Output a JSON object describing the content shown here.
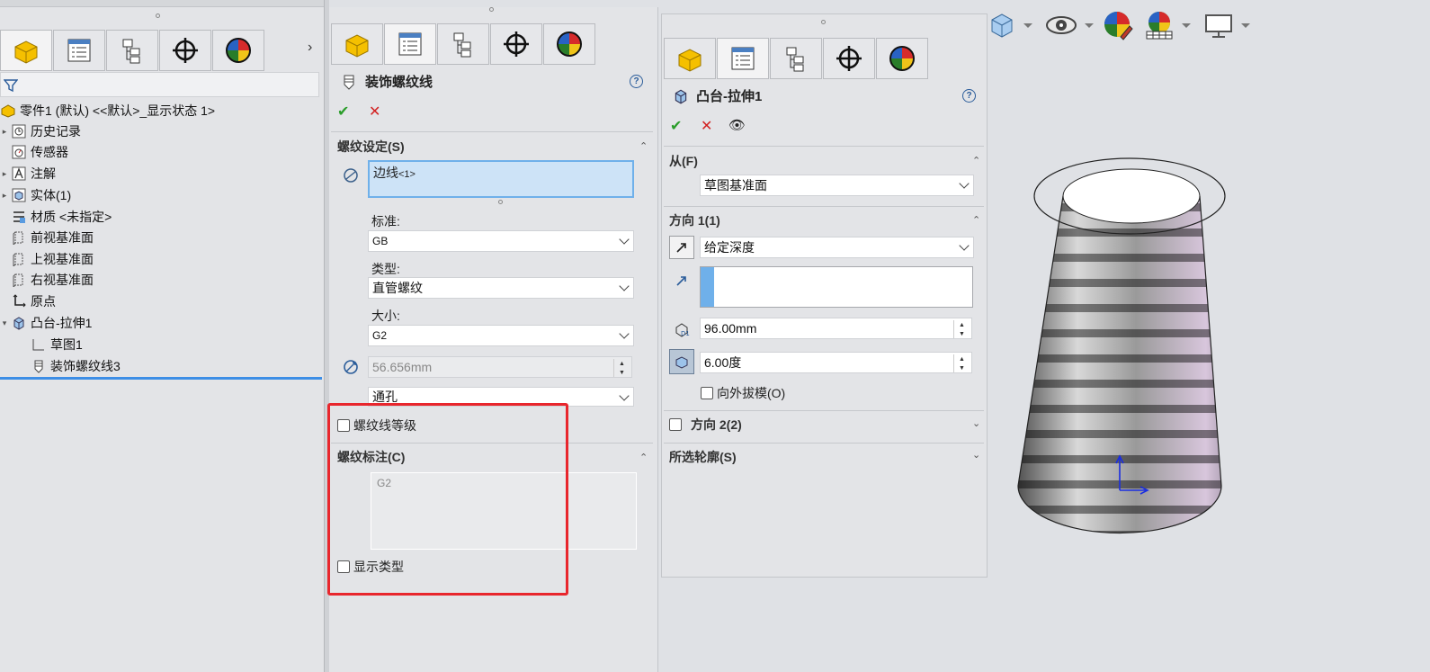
{
  "left_panel": {
    "filter_icon": "filter-icon",
    "tree": [
      {
        "label": "零件1 (默认) <<默认>_显示状态 1>",
        "icon": "part-icon",
        "expander": ""
      },
      {
        "label": "历史记录",
        "icon": "history-icon",
        "expander": "▸"
      },
      {
        "label": "传感器",
        "icon": "sensor-icon",
        "expander": ""
      },
      {
        "label": "注解",
        "icon": "annotation-icon",
        "expander": "▸"
      },
      {
        "label": "实体(1)",
        "icon": "solid-body-icon",
        "expander": "▸"
      },
      {
        "label": "材质 <未指定>",
        "icon": "material-icon",
        "expander": ""
      },
      {
        "label": "前视基准面",
        "icon": "plane-icon",
        "expander": ""
      },
      {
        "label": "上视基准面",
        "icon": "plane-icon",
        "expander": ""
      },
      {
        "label": "右视基准面",
        "icon": "plane-icon",
        "expander": ""
      },
      {
        "label": "原点",
        "icon": "origin-icon",
        "expander": ""
      },
      {
        "label": "凸台-拉伸1",
        "icon": "boss-extrude-icon",
        "expander": "▾"
      },
      {
        "label": "草图1",
        "icon": "sketch-icon",
        "expander": ""
      },
      {
        "label": "装饰螺纹线3",
        "icon": "cosmetic-thread-icon",
        "expander": ""
      }
    ]
  },
  "thread_panel": {
    "title": "装饰螺纹线",
    "help": "?",
    "section_settings": "螺纹设定(S)",
    "edge_value": "边线",
    "edge_sup": "<1>",
    "standard_label": "标准:",
    "standard_value": "GB",
    "type_label": "类型:",
    "type_value": "直管螺纹",
    "size_label": "大小:",
    "size_value": "G2",
    "diameter_value": "56.656mm",
    "end_condition_value": "通孔",
    "thread_class_label": "螺纹线等级",
    "section_callout": "螺纹标注(C)",
    "callout_value": "G2",
    "show_type_label": "显示类型"
  },
  "extrude_panel": {
    "title": "凸台-拉伸1",
    "help": "?",
    "section_from": "从(F)",
    "from_value": "草图基准面",
    "section_dir1": "方向 1(1)",
    "dir1_end_condition": "给定深度",
    "depth_value": "96.00mm",
    "draft_value": "6.00度",
    "draft_outward_label": "向外拔模(O)",
    "section_dir2": "方向 2(2)",
    "section_contours": "所选轮廓(S)"
  },
  "toolbar_icons": [
    "view-orientation-icon",
    "hide-show-icon",
    "edit-appearance-icon",
    "apply-scene-icon",
    "display-settings-icon"
  ],
  "colors": {
    "accent_blue": "#3d8ee6",
    "highlight_red": "#e8262d",
    "ok_green": "#2a9d2a",
    "cancel_red": "#d22222",
    "selection_bg": "#cde3f7"
  }
}
